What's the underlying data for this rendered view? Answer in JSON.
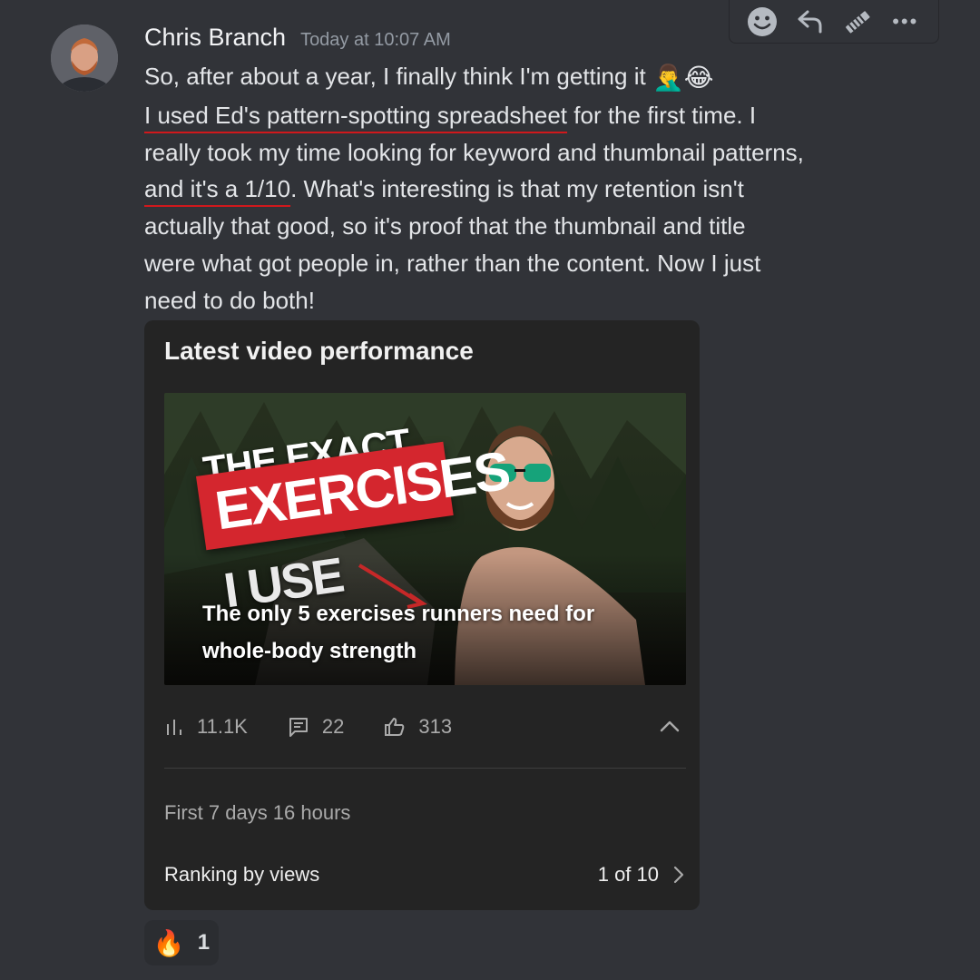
{
  "toolbar": {
    "icons": [
      "add-reaction-icon",
      "reply-icon",
      "edit-icon",
      "more-icon"
    ],
    "more_label": "•••"
  },
  "message": {
    "author": "Chris Branch",
    "timestamp": "Today at 10:07 AM",
    "line1": "So, after about a year, I finally think I'm getting it",
    "line1_emojis": "🤦‍♂️😂",
    "line2_underlined": "I used Ed's pattern-spotting spreadsheet",
    "line2_rest": " for the first time. I",
    "line3": "really took my time looking for keyword and thumbnail patterns,",
    "line4_underlined": "and it's a 1/10",
    "line4_rest": ". What's interesting is that my retention isn't",
    "line5": "actually that good, so it's proof that the thumbnail and title",
    "line6": "were what got people in, rather than the content. Now I just",
    "line7": "need to do both!"
  },
  "embed": {
    "title": "Latest video performance",
    "thumbnail": {
      "overlay_line1": "THE EXACT",
      "overlay_line2": "EXERCISES",
      "overlay_line3": "I USE",
      "video_title_line1": "The only 5 exercises runners need for",
      "video_title_line2": "whole-body strength"
    },
    "stats": {
      "views": "11.1K",
      "comments": "22",
      "likes": "313"
    },
    "period": "First 7 days 16 hours",
    "ranking_label": "Ranking by views",
    "ranking_value": "1 of 10"
  },
  "reaction": {
    "emoji": "🔥",
    "count": "1"
  },
  "colors": {
    "background": "#313338",
    "card": "#242424",
    "underline": "#d0181c",
    "banner_red": "#d4262e"
  }
}
